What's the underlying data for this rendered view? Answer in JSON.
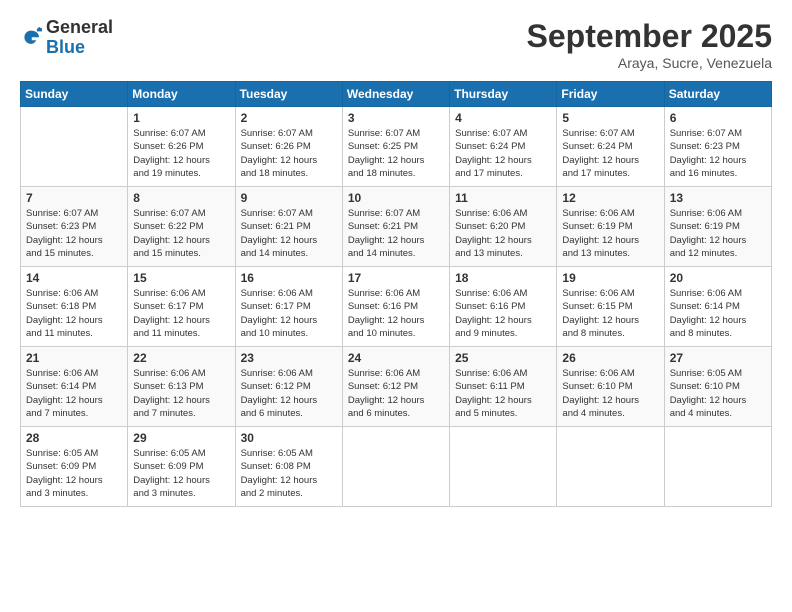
{
  "logo": {
    "general": "General",
    "blue": "Blue"
  },
  "header": {
    "title": "September 2025",
    "location": "Araya, Sucre, Venezuela"
  },
  "weekdays": [
    "Sunday",
    "Monday",
    "Tuesday",
    "Wednesday",
    "Thursday",
    "Friday",
    "Saturday"
  ],
  "weeks": [
    [
      {
        "day": "",
        "info": ""
      },
      {
        "day": "1",
        "info": "Sunrise: 6:07 AM\nSunset: 6:26 PM\nDaylight: 12 hours\nand 19 minutes."
      },
      {
        "day": "2",
        "info": "Sunrise: 6:07 AM\nSunset: 6:26 PM\nDaylight: 12 hours\nand 18 minutes."
      },
      {
        "day": "3",
        "info": "Sunrise: 6:07 AM\nSunset: 6:25 PM\nDaylight: 12 hours\nand 18 minutes."
      },
      {
        "day": "4",
        "info": "Sunrise: 6:07 AM\nSunset: 6:24 PM\nDaylight: 12 hours\nand 17 minutes."
      },
      {
        "day": "5",
        "info": "Sunrise: 6:07 AM\nSunset: 6:24 PM\nDaylight: 12 hours\nand 17 minutes."
      },
      {
        "day": "6",
        "info": "Sunrise: 6:07 AM\nSunset: 6:23 PM\nDaylight: 12 hours\nand 16 minutes."
      }
    ],
    [
      {
        "day": "7",
        "info": "Sunrise: 6:07 AM\nSunset: 6:23 PM\nDaylight: 12 hours\nand 15 minutes."
      },
      {
        "day": "8",
        "info": "Sunrise: 6:07 AM\nSunset: 6:22 PM\nDaylight: 12 hours\nand 15 minutes."
      },
      {
        "day": "9",
        "info": "Sunrise: 6:07 AM\nSunset: 6:21 PM\nDaylight: 12 hours\nand 14 minutes."
      },
      {
        "day": "10",
        "info": "Sunrise: 6:07 AM\nSunset: 6:21 PM\nDaylight: 12 hours\nand 14 minutes."
      },
      {
        "day": "11",
        "info": "Sunrise: 6:06 AM\nSunset: 6:20 PM\nDaylight: 12 hours\nand 13 minutes."
      },
      {
        "day": "12",
        "info": "Sunrise: 6:06 AM\nSunset: 6:19 PM\nDaylight: 12 hours\nand 13 minutes."
      },
      {
        "day": "13",
        "info": "Sunrise: 6:06 AM\nSunset: 6:19 PM\nDaylight: 12 hours\nand 12 minutes."
      }
    ],
    [
      {
        "day": "14",
        "info": "Sunrise: 6:06 AM\nSunset: 6:18 PM\nDaylight: 12 hours\nand 11 minutes."
      },
      {
        "day": "15",
        "info": "Sunrise: 6:06 AM\nSunset: 6:17 PM\nDaylight: 12 hours\nand 11 minutes."
      },
      {
        "day": "16",
        "info": "Sunrise: 6:06 AM\nSunset: 6:17 PM\nDaylight: 12 hours\nand 10 minutes."
      },
      {
        "day": "17",
        "info": "Sunrise: 6:06 AM\nSunset: 6:16 PM\nDaylight: 12 hours\nand 10 minutes."
      },
      {
        "day": "18",
        "info": "Sunrise: 6:06 AM\nSunset: 6:16 PM\nDaylight: 12 hours\nand 9 minutes."
      },
      {
        "day": "19",
        "info": "Sunrise: 6:06 AM\nSunset: 6:15 PM\nDaylight: 12 hours\nand 8 minutes."
      },
      {
        "day": "20",
        "info": "Sunrise: 6:06 AM\nSunset: 6:14 PM\nDaylight: 12 hours\nand 8 minutes."
      }
    ],
    [
      {
        "day": "21",
        "info": "Sunrise: 6:06 AM\nSunset: 6:14 PM\nDaylight: 12 hours\nand 7 minutes."
      },
      {
        "day": "22",
        "info": "Sunrise: 6:06 AM\nSunset: 6:13 PM\nDaylight: 12 hours\nand 7 minutes."
      },
      {
        "day": "23",
        "info": "Sunrise: 6:06 AM\nSunset: 6:12 PM\nDaylight: 12 hours\nand 6 minutes."
      },
      {
        "day": "24",
        "info": "Sunrise: 6:06 AM\nSunset: 6:12 PM\nDaylight: 12 hours\nand 6 minutes."
      },
      {
        "day": "25",
        "info": "Sunrise: 6:06 AM\nSunset: 6:11 PM\nDaylight: 12 hours\nand 5 minutes."
      },
      {
        "day": "26",
        "info": "Sunrise: 6:06 AM\nSunset: 6:10 PM\nDaylight: 12 hours\nand 4 minutes."
      },
      {
        "day": "27",
        "info": "Sunrise: 6:05 AM\nSunset: 6:10 PM\nDaylight: 12 hours\nand 4 minutes."
      }
    ],
    [
      {
        "day": "28",
        "info": "Sunrise: 6:05 AM\nSunset: 6:09 PM\nDaylight: 12 hours\nand 3 minutes."
      },
      {
        "day": "29",
        "info": "Sunrise: 6:05 AM\nSunset: 6:09 PM\nDaylight: 12 hours\nand 3 minutes."
      },
      {
        "day": "30",
        "info": "Sunrise: 6:05 AM\nSunset: 6:08 PM\nDaylight: 12 hours\nand 2 minutes."
      },
      {
        "day": "",
        "info": ""
      },
      {
        "day": "",
        "info": ""
      },
      {
        "day": "",
        "info": ""
      },
      {
        "day": "",
        "info": ""
      }
    ]
  ]
}
